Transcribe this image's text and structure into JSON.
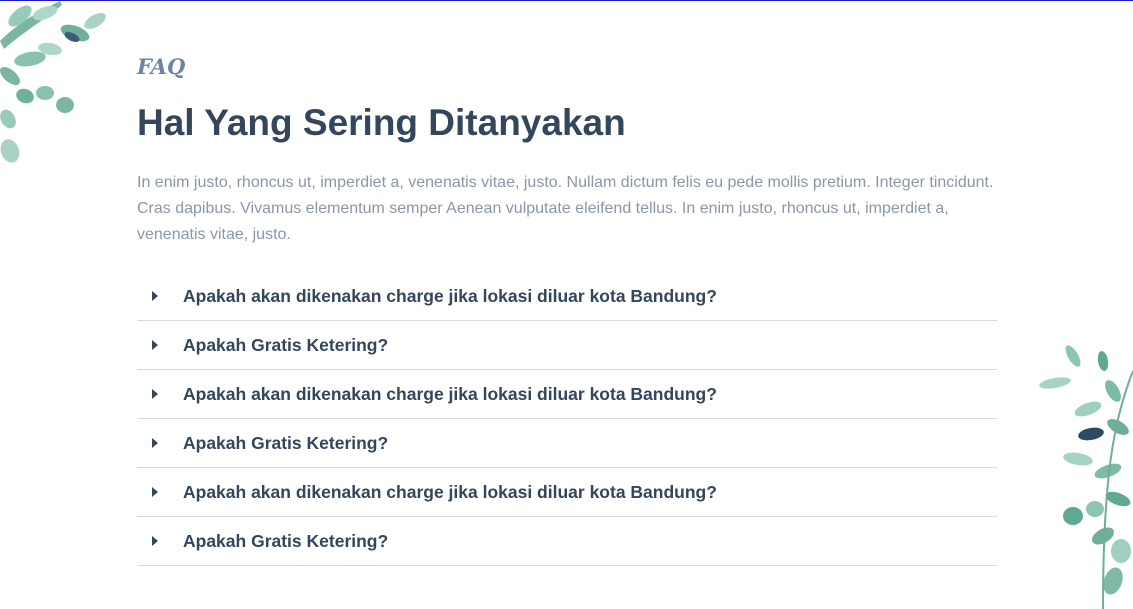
{
  "faq": {
    "eyebrow": "FAQ",
    "heading": "Hal Yang Sering Ditanyakan",
    "intro": "In enim justo, rhoncus ut, imperdiet a, venenatis vitae, justo. Nullam dictum felis eu pede mollis pretium. Integer tincidunt. Cras dapibus. Vivamus elementum semper Aenean vulputate eleifend tellus. In enim justo, rhoncus ut, imperdiet a, venenatis vitae, justo.",
    "items": [
      {
        "question": "Apakah akan dikenakan charge jika lokasi diluar kota Bandung?"
      },
      {
        "question": "Apakah Gratis Ketering?"
      },
      {
        "question": "Apakah akan dikenakan charge jika lokasi diluar kota Bandung?"
      },
      {
        "question": "Apakah Gratis Ketering?"
      },
      {
        "question": "Apakah akan dikenakan charge jika lokasi diluar kota Bandung?"
      },
      {
        "question": "Apakah Gratis Ketering?"
      }
    ]
  },
  "colors": {
    "heading": "#34465c",
    "eyebrow": "#6d83a3",
    "body_text": "#8a97a8",
    "divider": "#d6d9dd",
    "leaf_light": "#8cc5b4",
    "leaf_mid": "#5fa893",
    "leaf_dark": "#2c4a63"
  },
  "decorations": [
    "leaf-branch-top-left",
    "leaf-branch-bottom-right"
  ]
}
